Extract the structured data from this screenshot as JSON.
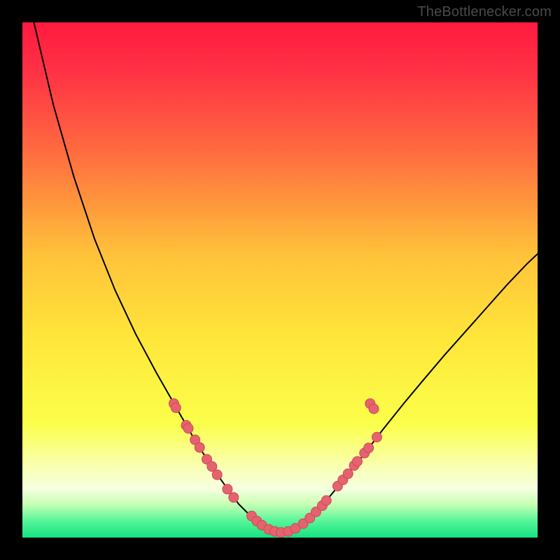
{
  "watermark": "TheBottlenecker.com",
  "chart_data": {
    "type": "line",
    "title": "",
    "xlabel": "",
    "ylabel": "",
    "xlim": [
      0,
      1
    ],
    "ylim": [
      0,
      1
    ],
    "background_gradient": {
      "stops": [
        {
          "pos": 0.0,
          "color": "#ff1a3f"
        },
        {
          "pos": 0.1,
          "color": "#ff3345"
        },
        {
          "pos": 0.25,
          "color": "#ff6b3f"
        },
        {
          "pos": 0.45,
          "color": "#ffc23a"
        },
        {
          "pos": 0.62,
          "color": "#ffe73a"
        },
        {
          "pos": 0.78,
          "color": "#fbff4a"
        },
        {
          "pos": 0.86,
          "color": "#faffb0"
        },
        {
          "pos": 0.905,
          "color": "#f5ffe0"
        },
        {
          "pos": 0.935,
          "color": "#c8ffb4"
        },
        {
          "pos": 0.968,
          "color": "#55f59a"
        },
        {
          "pos": 1.0,
          "color": "#15e27f"
        }
      ]
    },
    "series": [
      {
        "name": "bottleneck-curve",
        "x": [
          0.02,
          0.06,
          0.1,
          0.14,
          0.18,
          0.22,
          0.26,
          0.3,
          0.32,
          0.34,
          0.36,
          0.38,
          0.4,
          0.42,
          0.44,
          0.46,
          0.48,
          0.5,
          0.52,
          0.54,
          0.56,
          0.58,
          0.62,
          0.66,
          0.7,
          0.74,
          0.78,
          0.82,
          0.86,
          0.9,
          0.94,
          0.98,
          1.01,
          1.04
        ],
        "y": [
          1.01,
          0.84,
          0.7,
          0.58,
          0.48,
          0.395,
          0.32,
          0.25,
          0.215,
          0.18,
          0.15,
          0.12,
          0.092,
          0.065,
          0.045,
          0.028,
          0.016,
          0.01,
          0.012,
          0.022,
          0.04,
          0.06,
          0.108,
          0.158,
          0.21,
          0.26,
          0.308,
          0.355,
          0.4,
          0.445,
          0.49,
          0.532,
          0.56,
          0.59
        ]
      }
    ],
    "markers": [
      {
        "x": 0.294,
        "y": 0.26
      },
      {
        "x": 0.298,
        "y": 0.252
      },
      {
        "x": 0.318,
        "y": 0.218
      },
      {
        "x": 0.322,
        "y": 0.212
      },
      {
        "x": 0.335,
        "y": 0.19
      },
      {
        "x": 0.344,
        "y": 0.175
      },
      {
        "x": 0.358,
        "y": 0.152
      },
      {
        "x": 0.368,
        "y": 0.138
      },
      {
        "x": 0.378,
        "y": 0.122
      },
      {
        "x": 0.398,
        "y": 0.094
      },
      {
        "x": 0.41,
        "y": 0.078
      },
      {
        "x": 0.445,
        "y": 0.042
      },
      {
        "x": 0.455,
        "y": 0.032
      },
      {
        "x": 0.465,
        "y": 0.024
      },
      {
        "x": 0.478,
        "y": 0.016
      },
      {
        "x": 0.49,
        "y": 0.012
      },
      {
        "x": 0.502,
        "y": 0.01
      },
      {
        "x": 0.516,
        "y": 0.012
      },
      {
        "x": 0.53,
        "y": 0.018
      },
      {
        "x": 0.545,
        "y": 0.027
      },
      {
        "x": 0.558,
        "y": 0.038
      },
      {
        "x": 0.57,
        "y": 0.05
      },
      {
        "x": 0.582,
        "y": 0.062
      },
      {
        "x": 0.59,
        "y": 0.072
      },
      {
        "x": 0.612,
        "y": 0.1
      },
      {
        "x": 0.622,
        "y": 0.112
      },
      {
        "x": 0.632,
        "y": 0.124
      },
      {
        "x": 0.644,
        "y": 0.14
      },
      {
        "x": 0.65,
        "y": 0.148
      },
      {
        "x": 0.664,
        "y": 0.164
      },
      {
        "x": 0.672,
        "y": 0.174
      },
      {
        "x": 0.688,
        "y": 0.195
      },
      {
        "x": 0.675,
        "y": 0.26
      },
      {
        "x": 0.682,
        "y": 0.25
      }
    ],
    "marker_style": {
      "fill": "#e4636f",
      "stroke": "#cc4a57",
      "r": 7
    }
  }
}
